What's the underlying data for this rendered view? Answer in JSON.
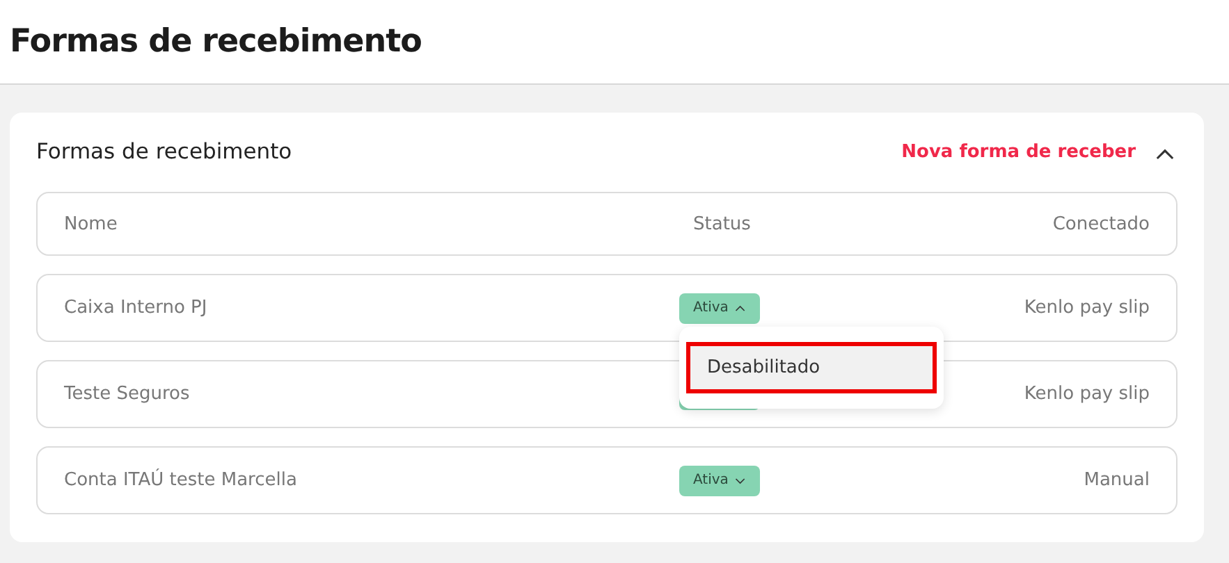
{
  "page_title": "Formas de recebimento",
  "card": {
    "title": "Formas de recebimento",
    "action": "Nova forma de receber",
    "expanded": true
  },
  "table": {
    "columns": [
      "Nome",
      "Status",
      "Conectado"
    ],
    "rows": [
      {
        "name": "Caixa Interno PJ",
        "status": {
          "label": "Ativa",
          "expanded": true
        },
        "connected": "Kenlo pay slip"
      },
      {
        "name": "Teste Seguros",
        "status": {
          "expanded": false
        },
        "connected": "Kenlo pay slip"
      },
      {
        "name": "Conta ITAÚ teste Marcella",
        "status": {
          "label": "Ativa",
          "expanded": false
        },
        "connected": "Manual"
      }
    ]
  },
  "status_menu": {
    "items": [
      {
        "label": "Desabilitado",
        "selected": true
      }
    ]
  }
}
